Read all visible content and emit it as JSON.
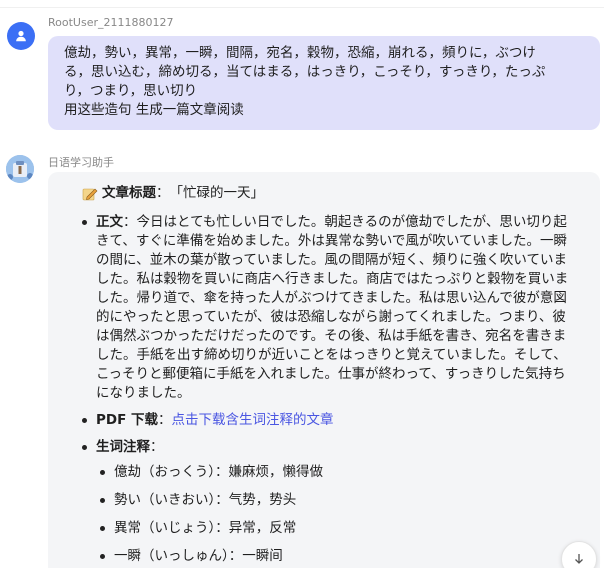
{
  "user_message": {
    "sender": "RootUser_2111880127",
    "lines": [
      "億劫，勢い，異常，一瞬，間隔，宛名，穀物，恐縮，崩れる，頻りに，ぶつけ",
      "る，思い込む，締め切る，当てはまる，はっきり，こっそり，すっきり，たっぷ",
      "り，つまり，思い切り",
      "用这些造句 生成一篇文章阅读"
    ]
  },
  "bot_message": {
    "sender": "日语学习助手",
    "title_label": "文章标题",
    "title_sep": "：",
    "title_value": "「忙碌的一天」",
    "body_label": "正文",
    "body_sep": "：",
    "body_lines": [
      "今日はとても忙しい日でした。朝起きるのが億劫でしたが、思い切り起",
      "きて、すぐに準備を始めました。外は異常な勢いで風が吹いていました。一瞬",
      "の間に、並木の葉が散っていました。風の間隔が短く、頻りに強く吹いていま",
      "した。私は穀物を買いに商店へ行きました。商店ではたっぷりと穀物を買いま",
      "した。帰り道で、傘を持った人がぶつけてきました。私は思い込んで彼が意図",
      "的にやったと思っていたが、彼は恐縮しながら謝ってくれました。つまり、彼",
      "は偶然ぶつかっただけだったのです。その後、私は手紙を書き、宛名を書きま",
      "した。手紙を出す締め切りが近いことをはっきりと覚えていました。そして、",
      "こっそりと郵便箱に手紙を入れました。仕事が終わって、すっきりした気持ち",
      "になりました。"
    ],
    "pdf_label": "PDF 下载",
    "pdf_sep": "：",
    "pdf_link": "点击下载含生词注释的文章",
    "vocab_label": "生词注释",
    "vocab_sep": "：",
    "vocab": [
      "億劫（おっくう）：嫌麻烦，懒得做",
      "勢い（いきおい）：气势，势头",
      "異常（いじょう）：异常，反常",
      "一瞬（いっしゅん）：一瞬间"
    ]
  },
  "icons": {
    "user_avatar": "person-icon",
    "bot_avatar": "robot-icon",
    "title_emoji": "pencil-icon",
    "scroll": "arrow-down-icon"
  },
  "colors": {
    "user_bubble": "#e0e0fa",
    "bot_bubble": "#f4f5f7",
    "link": "#4a56e2",
    "user_avatar": "#3b6ff5"
  }
}
